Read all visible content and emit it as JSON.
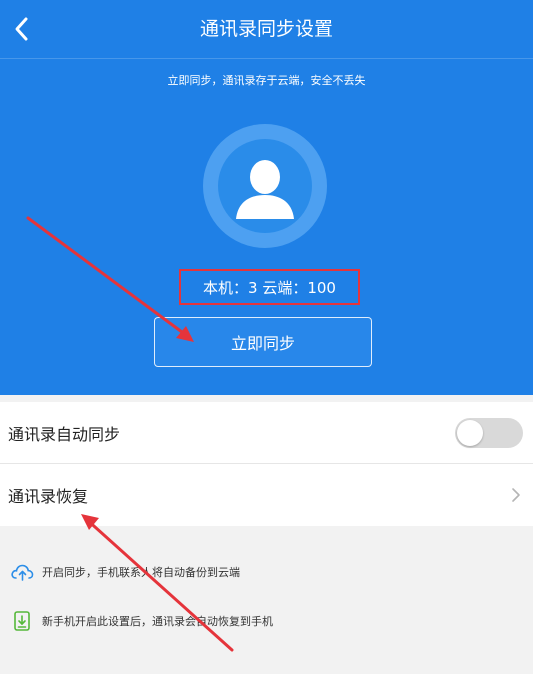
{
  "header": {
    "title": "通讯录同步设置",
    "back_icon": "chevron-left-icon"
  },
  "hero": {
    "subtitle": "立即同步，通讯录存于云端，安全不丢失",
    "avatar_icon": "user-icon",
    "counts_text": "本机：3  云端：100",
    "sync_button_label": "立即同步"
  },
  "settings": {
    "auto_sync_label": "通讯录自动同步",
    "auto_sync_enabled": false,
    "restore_label": "通讯录恢复"
  },
  "tips": [
    {
      "icon": "cloud-upload-icon",
      "text": "开启同步，手机联系人将自动备份到云端"
    },
    {
      "icon": "download-icon",
      "text": "新手机开启此设置后，通讯录会自动恢复到手机"
    }
  ],
  "colors": {
    "primary": "#1f80e6",
    "annotation_red": "#e5343b",
    "tip_icon_blue": "#2c8ee8",
    "tip_icon_green": "#55b83a"
  }
}
